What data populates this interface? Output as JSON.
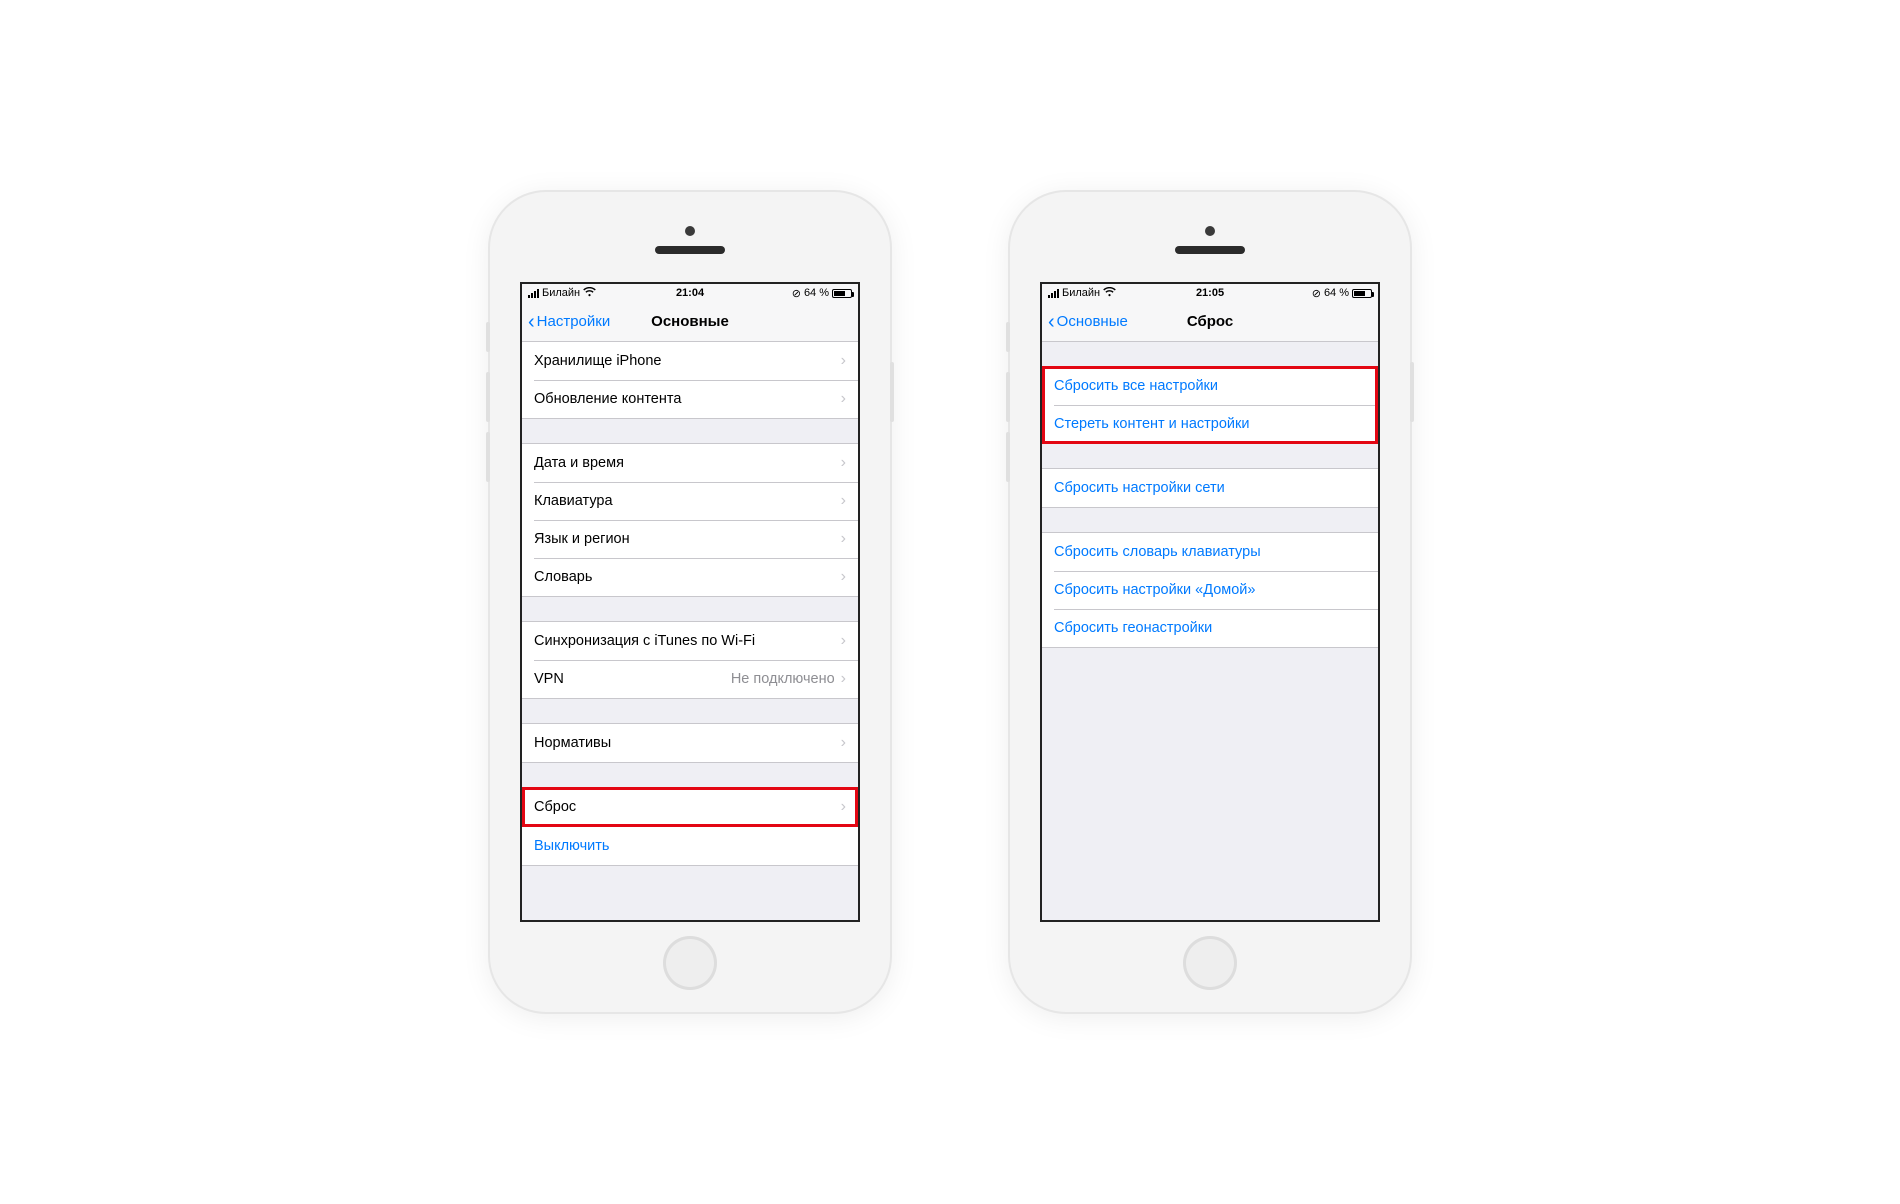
{
  "phone_left": {
    "status": {
      "carrier": "Билайн",
      "time": "21:04",
      "battery_text": "64 %"
    },
    "navbar": {
      "back_label": "Настройки",
      "title": "Основные"
    },
    "groups": [
      {
        "rows": [
          {
            "label": "Хранилище iPhone",
            "has_arrow": true
          },
          {
            "label": "Обновление контента",
            "has_arrow": true
          }
        ]
      },
      {
        "rows": [
          {
            "label": "Дата и время",
            "has_arrow": true
          },
          {
            "label": "Клавиатура",
            "has_arrow": true
          },
          {
            "label": "Язык и регион",
            "has_arrow": true
          },
          {
            "label": "Словарь",
            "has_arrow": true
          }
        ]
      },
      {
        "rows": [
          {
            "label": "Синхронизация с iTunes по Wi-Fi",
            "has_arrow": true
          },
          {
            "label": "VPN",
            "value": "Не подключено",
            "has_arrow": true
          }
        ]
      },
      {
        "rows": [
          {
            "label": "Нормативы",
            "has_arrow": true
          }
        ]
      },
      {
        "rows": [
          {
            "label": "Сброс",
            "has_arrow": true,
            "highlighted": true
          }
        ]
      },
      {
        "rows": [
          {
            "label": "Выключить",
            "link": true,
            "has_arrow": false
          }
        ]
      }
    ]
  },
  "phone_right": {
    "status": {
      "carrier": "Билайн",
      "time": "21:05",
      "battery_text": "64 %"
    },
    "navbar": {
      "back_label": "Основные",
      "title": "Сброс"
    },
    "groups": [
      {
        "highlighted": true,
        "rows": [
          {
            "label": "Сбросить все настройки",
            "link": true
          },
          {
            "label": "Стереть контент и настройки",
            "link": true
          }
        ]
      },
      {
        "rows": [
          {
            "label": "Сбросить настройки сети",
            "link": true
          }
        ]
      },
      {
        "rows": [
          {
            "label": "Сбросить словарь клавиатуры",
            "link": true
          },
          {
            "label": "Сбросить настройки «Домой»",
            "link": true
          },
          {
            "label": "Сбросить геонастройки",
            "link": true
          }
        ]
      }
    ]
  }
}
